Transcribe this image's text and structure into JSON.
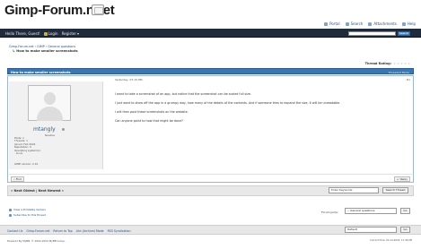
{
  "header": {
    "logo_text": "Gimp-Forum.n",
    "logo_suffix": "et",
    "links": [
      {
        "label": "Portal"
      },
      {
        "label": "Search"
      },
      {
        "label": "Attachments"
      },
      {
        "label": "Help"
      }
    ]
  },
  "navbar": {
    "greeting": "Hello There, Guest!",
    "login": "Login",
    "register": "Register",
    "search_placeholder": "",
    "search_button": "Search"
  },
  "breadcrumb": {
    "path": "Gimp-Forum.net › GIMP › General questions",
    "current": "How to make smaller screenshots"
  },
  "thread": {
    "rating_label": "Thread Rating:",
    "title": "How to make smaller screenshots",
    "mode": "Threaded Mode",
    "post_date": "Yesterday, 07:15 PM",
    "post_number": "#1",
    "user": {
      "name": "mtangly",
      "title": "Newbie",
      "stats": [
        "Posts: 1",
        "Threads: 1",
        "Joined: Feb 2024",
        "Reputation: 0",
        "Operating system(s):",
        "  · Linux"
      ],
      "gimp_version": "GIMP version: 2.10"
    },
    "message": [
      "I want to take a screenshot of an app, but notice that the screenshot can be scaled full size.",
      "I just want to show off the app in a grumpy way, how many of the details of the contents. And if someone tries to expand the size, it will be unreadable.",
      "I will then post these screenshots on the website.",
      "Can anyone point to how that might be done?"
    ],
    "find_button": "Find",
    "reply_button": "Reply"
  },
  "actions": {
    "nav": "« Next Oldest | Next Newest »",
    "keywords_placeholder": "Enter Keywords",
    "search_thread": "Search Thread"
  },
  "tools": {
    "items": [
      "View a Printable Version",
      "Subscribe to this thread"
    ],
    "forum_jump_label": "Forum Jump:",
    "forum_jump_value": "-- General questions",
    "go": "Go"
  },
  "footer": {
    "links": [
      "Contact Us",
      "Gimp-Forum.net",
      "Return to Top",
      "Lite (Archive) Mode",
      "RSS Syndication"
    ],
    "style_select": "Default",
    "go": "Go",
    "powered": "Powered By MyBB, © 2002-2024 MyBB Group.",
    "copyright": "Current time: 02-14-2024, 11:36 PM"
  },
  "colors": {
    "navbar": "#1f2a3a",
    "threadbar": "#3b76b4",
    "link": "#1e4d8c"
  }
}
